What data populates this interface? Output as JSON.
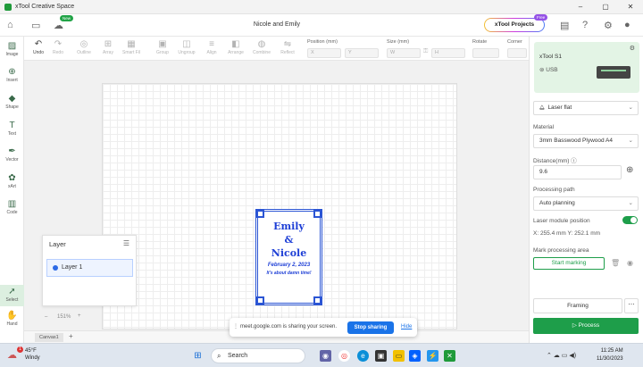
{
  "window": {
    "title": "xTool Creative Space",
    "controls": [
      "–",
      "▢",
      "✕"
    ]
  },
  "topbar": {
    "new_badge": "New",
    "doc_title": "Nicole and Emily",
    "projects_button": "xTool Projects",
    "free_badge": "Free"
  },
  "toolbar": {
    "undo": "Undo",
    "redo": "Redo",
    "outline": "Outline",
    "array": "Array",
    "smart_fill": "Smart Fil",
    "group": "Group",
    "ungroup": "Ungroup",
    "align": "Align",
    "arrange": "Arrange",
    "combine": "Combine",
    "reflect": "Reflect",
    "position_label": "Position (mm)",
    "x_placeholder": "X",
    "y_placeholder": "Y",
    "size_label": "Size (mm)",
    "w_placeholder": "W",
    "h_placeholder": "H",
    "rotate_label": "Rotate",
    "corner_label": "Corner"
  },
  "left_tools": [
    "Image",
    "Insert",
    "Shape",
    "Text",
    "Vector",
    "xArt",
    "Code",
    "Select",
    "Hand"
  ],
  "design": {
    "line1": "Emily",
    "line2": "&",
    "line3": "Nicole",
    "date": "February 2, 2023",
    "tagline": "It's about damn time!"
  },
  "layer_panel": {
    "title": "Layer",
    "layers": [
      "Layer 1"
    ]
  },
  "zoom": "151%",
  "canvas_tab": "Canvas1",
  "share_bar": {
    "message": "meet.google.com is sharing your screen.",
    "stop_button": "Stop sharing",
    "hide_link": "Hide"
  },
  "right_panel": {
    "device_name": "xTool S1",
    "connection": "USB",
    "processing_mode": "Laser flat",
    "material_label": "Material",
    "material_value": "3mm Basswood Plywood A4",
    "distance_label": "Distance(mm)",
    "distance_value": "9.6",
    "processing_path_label": "Processing path",
    "processing_path_value": "Auto planning",
    "module_position_label": "Laser module position",
    "module_position_value": "X: 255.4 mm   Y: 252.1 mm",
    "mark_area_label": "Mark processing area",
    "start_marking": "Start marking",
    "framing": "Framing",
    "process": "Process"
  },
  "taskbar": {
    "weather_temp": "45°F",
    "weather_desc": "Windy",
    "notification_count": "1",
    "search_label": "Search",
    "time": "11:25 AM",
    "date": "11/30/2023"
  },
  "colors": {
    "accent_green": "#1e9e4a",
    "design_blue": "#2b55d4",
    "meet_blue": "#1a73e8"
  }
}
